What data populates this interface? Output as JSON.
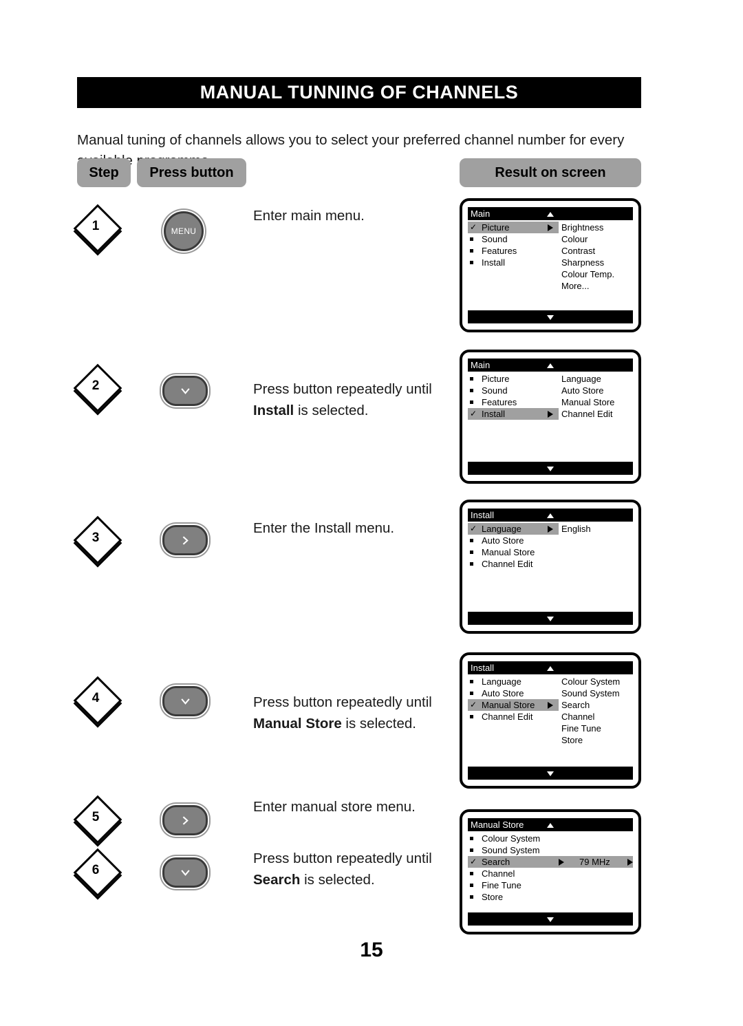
{
  "page": {
    "title": "MANUAL TUNNING OF CHANNELS",
    "intro": "Manual tuning of channels allows you to select your preferred channel number for every available programme.",
    "page_number": "15"
  },
  "column_headers": {
    "step": "Step",
    "press_button": "Press button",
    "result_on_screen": "Result on screen"
  },
  "colors": {
    "banner_background": "#000000",
    "banner_text": "#ffffff",
    "tab_background": "#a0a0a0",
    "highlight": "#a0a0a0",
    "button_face": "#808080",
    "button_rim": "#3a3a3a"
  },
  "steps": [
    {
      "number": "1",
      "button": {
        "type": "round",
        "label": "MENU",
        "icon": "menu-button"
      },
      "instruction_line1": "Enter main menu.",
      "instruction_bold": "",
      "instruction_line2_suffix": ""
    },
    {
      "number": "2",
      "button": {
        "type": "pill",
        "label": "",
        "icon": "chevron-down-icon"
      },
      "instruction_line1": "Press button repeatedly until",
      "instruction_bold": "Install",
      "instruction_line2_suffix": " is selected."
    },
    {
      "number": "3",
      "button": {
        "type": "pill",
        "label": "",
        "icon": "chevron-right-icon"
      },
      "instruction_line1": "Enter the Install menu.",
      "instruction_bold": "",
      "instruction_line2_suffix": ""
    },
    {
      "number": "4",
      "button": {
        "type": "pill",
        "label": "",
        "icon": "chevron-down-icon"
      },
      "instruction_line1": "Press button repeatedly until",
      "instruction_bold": "Manual Store",
      "instruction_line2_suffix": " is selected."
    },
    {
      "number": "5",
      "button": {
        "type": "pill",
        "label": "",
        "icon": "chevron-right-icon"
      },
      "instruction_line1": "Enter manual store menu.",
      "instruction_bold": "",
      "instruction_line2_suffix": ""
    },
    {
      "number": "6",
      "button": {
        "type": "pill",
        "label": "",
        "icon": "chevron-down-icon"
      },
      "instruction_line1": "Press button repeatedly until",
      "instruction_bold": "Search",
      "instruction_line2_suffix": " is selected."
    }
  ],
  "screens": [
    {
      "id": "screen-1",
      "title": "Main",
      "left_items": [
        {
          "label": "Picture",
          "selected": true,
          "arrow": true
        },
        {
          "label": "Sound",
          "selected": false,
          "arrow": false
        },
        {
          "label": "Features",
          "selected": false,
          "arrow": false
        },
        {
          "label": "Install",
          "selected": false,
          "arrow": false
        }
      ],
      "right_items": [
        "Brightness",
        "Colour",
        "Contrast",
        "Sharpness",
        "Colour Temp.",
        "More..."
      ]
    },
    {
      "id": "screen-2",
      "title": "Main",
      "left_items": [
        {
          "label": "Picture",
          "selected": false,
          "arrow": false
        },
        {
          "label": "Sound",
          "selected": false,
          "arrow": false
        },
        {
          "label": "Features",
          "selected": false,
          "arrow": false
        },
        {
          "label": "Install",
          "selected": true,
          "arrow": true
        }
      ],
      "right_items": [
        "Language",
        "Auto Store",
        "Manual Store",
        "Channel Edit"
      ]
    },
    {
      "id": "screen-3",
      "title": "Install",
      "left_items": [
        {
          "label": "Language",
          "selected": true,
          "arrow": true
        },
        {
          "label": "Auto Store",
          "selected": false,
          "arrow": false
        },
        {
          "label": "Manual Store",
          "selected": false,
          "arrow": false
        },
        {
          "label": "Channel Edit",
          "selected": false,
          "arrow": false
        }
      ],
      "right_items": [
        "English"
      ]
    },
    {
      "id": "screen-4",
      "title": "Install",
      "left_items": [
        {
          "label": "Language",
          "selected": false,
          "arrow": false
        },
        {
          "label": "Auto Store",
          "selected": false,
          "arrow": false
        },
        {
          "label": "Manual Store",
          "selected": true,
          "arrow": true
        },
        {
          "label": "Channel Edit",
          "selected": false,
          "arrow": false
        }
      ],
      "right_items": [
        "Colour System",
        "Sound System",
        "Search",
        "Channel",
        "Fine Tune",
        "Store"
      ]
    },
    {
      "id": "screen-5",
      "title": "Manual Store",
      "left_items": [
        {
          "label": "Colour System",
          "selected": false,
          "arrow": false
        },
        {
          "label": "Sound System",
          "selected": false,
          "arrow": false
        },
        {
          "label": "Search",
          "selected": true,
          "arrow": true,
          "value": "79 MHz",
          "value_arrow": true,
          "full_width": true
        },
        {
          "label": "Channel",
          "selected": false,
          "arrow": false
        },
        {
          "label": "Fine Tune",
          "selected": false,
          "arrow": false
        },
        {
          "label": "Store",
          "selected": false,
          "arrow": false
        }
      ],
      "right_items": []
    }
  ]
}
